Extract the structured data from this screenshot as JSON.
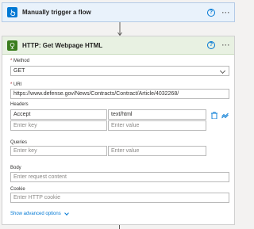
{
  "trigger": {
    "title": "Manually trigger a flow",
    "icon": "hand-tap-icon",
    "color": "#0078d4"
  },
  "action": {
    "title": "HTTP: Get Webpage HTML",
    "icon": "globe-icon",
    "color": "#3a7d1d",
    "method": {
      "required_mark": "*",
      "label": "Method",
      "value": "GET"
    },
    "uri": {
      "required_mark": "*",
      "label": "URI",
      "value": "https://www.defense.gov/News/Contracts/Contract/Article/4032268/"
    },
    "headers": {
      "label": "Headers",
      "rows": [
        {
          "key": "Accept",
          "value": "text/html"
        }
      ],
      "key_placeholder": "Enter key",
      "value_placeholder": "Enter value"
    },
    "queries": {
      "label": "Queries",
      "key_placeholder": "Enter key",
      "value_placeholder": "Enter value"
    },
    "body": {
      "label": "Body",
      "placeholder": "Enter request content"
    },
    "cookie": {
      "label": "Cookie",
      "placeholder": "Enter HTTP cookie"
    },
    "advanced_link": "Show advanced options"
  }
}
